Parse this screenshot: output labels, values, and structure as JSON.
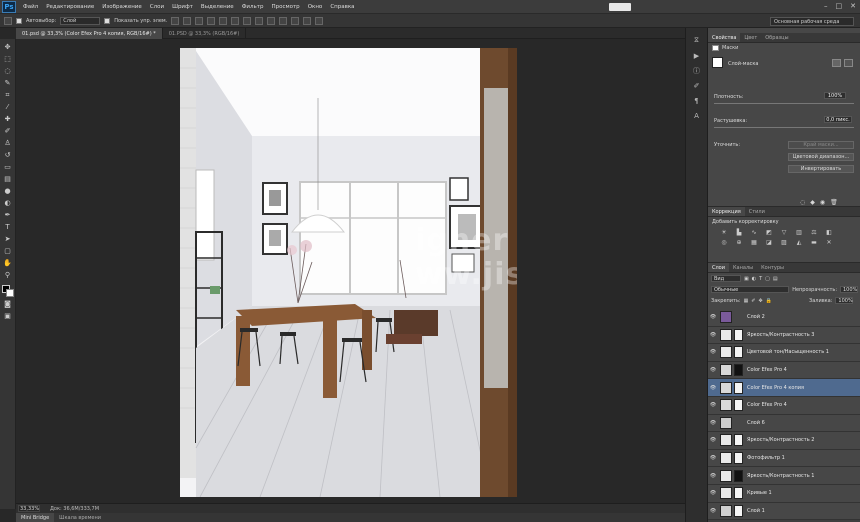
{
  "menubar": {
    "items": [
      "Файл",
      "Редактирование",
      "Изображение",
      "Слои",
      "Шрифт",
      "Выделение",
      "Фильтр",
      "Просмотр",
      "Окно",
      "Справка"
    ],
    "window_controls": [
      "–",
      "□",
      "✕"
    ]
  },
  "options": {
    "autoselect_label": "Автовыбор:",
    "autoselect_value": "Слой",
    "show_controls_label": "Показать упр. элем."
  },
  "workspace": {
    "value": "Основная рабочая среда"
  },
  "tabs": [
    {
      "label": "01.psd @ 33,3% (Color Efex Pro 4 копия, RGB/16#) *",
      "active": true
    },
    {
      "label": "01.PSD @ 33,3% (RGB/16#)",
      "active": false
    }
  ],
  "status": {
    "zoom": "33,33%",
    "doc": "Док: 36,6M/333,7M"
  },
  "bottom_tabs": [
    "Mini Bridge",
    "Шкала времени"
  ],
  "properties": {
    "tabs": [
      "Свойства",
      "Цвет",
      "Образцы"
    ],
    "header": "Маски",
    "mask_label": "Слой-маска",
    "density_label": "Плотность:",
    "density_value": "100%",
    "feather_label": "Растушевка:",
    "feather_value": "0,0 пикс.",
    "refine_label": "Уточнить:",
    "buttons": [
      "Край маски...",
      "Цветовой диапазон...",
      "Инвертировать"
    ]
  },
  "adjustments": {
    "tabs": [
      "Коррекция",
      "Стили"
    ],
    "title": "Добавить корректировку"
  },
  "layers": {
    "tabs": [
      "Слои",
      "Каналы",
      "Контуры"
    ],
    "kind_value": "Вид",
    "blend_value": "Обычные",
    "opacity_label": "Непрозрачность:",
    "opacity_value": "100%",
    "lock_label": "Закрепить:",
    "fill_label": "Заливка:",
    "fill_value": "100%",
    "rows": [
      {
        "name": "Слой 2",
        "thumb": "#7a5a9a",
        "mask": false,
        "selected": false
      },
      {
        "name": "Яркость/Контрастность 3",
        "thumb": "#e9e9e9",
        "mask": true,
        "selected": false
      },
      {
        "name": "Цветовой тон/Насыщенность 1",
        "thumb": "#e9e9e9",
        "mask": true,
        "selected": false
      },
      {
        "name": "Color Efex Pro 4",
        "thumb": "#d8d8d8",
        "mask": true,
        "selected": false
      },
      {
        "name": "Color Efex Pro 4 копия",
        "thumb": "#d8d8d8",
        "mask": true,
        "selected": true
      },
      {
        "name": "Color Efex Pro 4",
        "thumb": "#d8d8d8",
        "mask": true,
        "selected": false
      },
      {
        "name": "Слой 6",
        "thumb": "#cccccc",
        "mask": false,
        "selected": false
      },
      {
        "name": "Яркость/Контрастность 2",
        "thumb": "#e9e9e9",
        "mask": true,
        "selected": false
      },
      {
        "name": "Фотофильтр 1",
        "thumb": "#e9e9e9",
        "mask": true,
        "selected": false
      },
      {
        "name": "Яркость/Контрастность 1",
        "thumb": "#e9e9e9",
        "mask": true,
        "selected": false
      },
      {
        "name": "Кривые 1",
        "thumb": "#e9e9e9",
        "mask": true,
        "selected": false
      },
      {
        "name": "Слой 1",
        "thumb": "#cfcfcf",
        "mask": true,
        "selected": false
      }
    ]
  },
  "watermark": {
    "text": "igner 计网 ww.jishewo.com"
  }
}
